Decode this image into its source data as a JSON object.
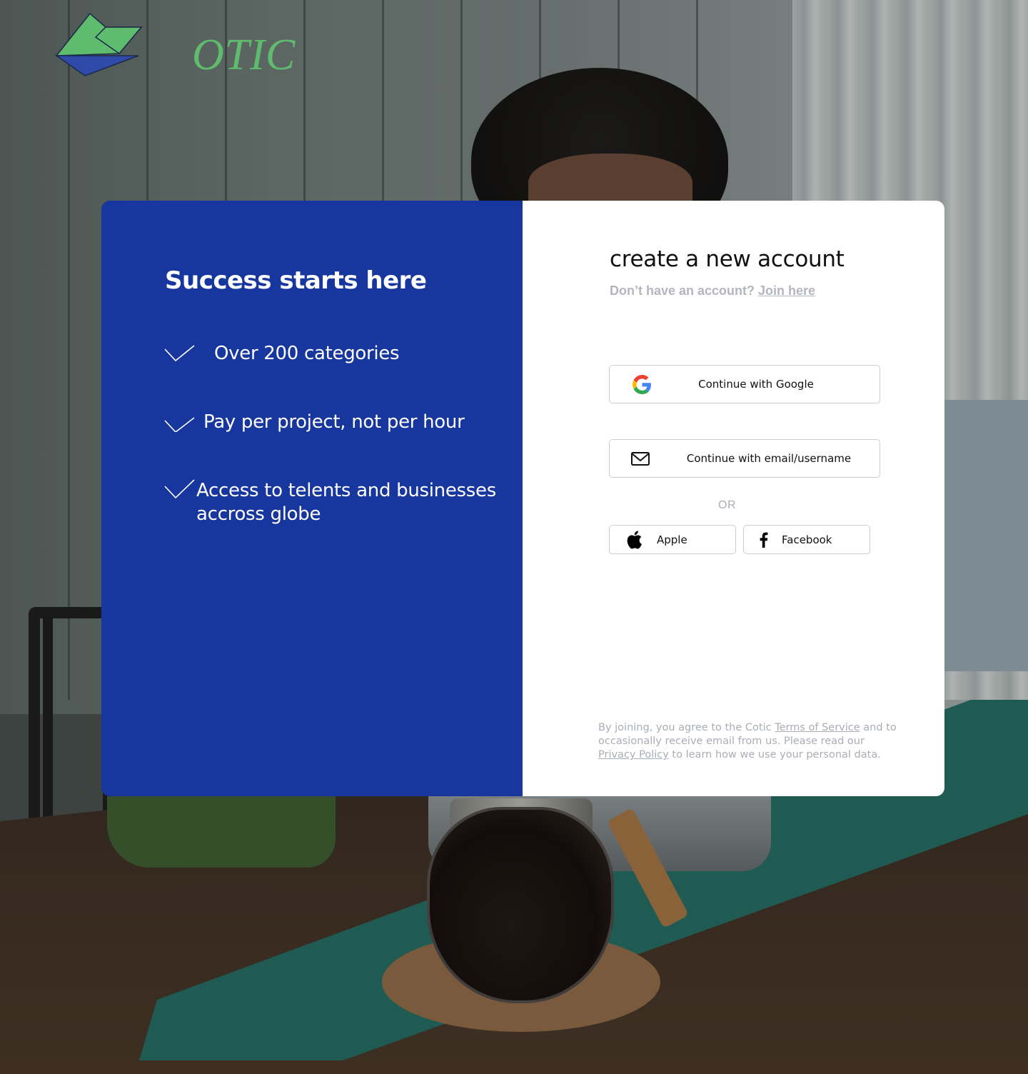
{
  "brand": {
    "logo_text": "OTIC",
    "colors": {
      "green": "#5fbb6e",
      "blue": "#2f4aa8",
      "panel_blue": "#17369e"
    }
  },
  "left": {
    "title": "Success starts here",
    "features": [
      {
        "text": "Over 200 categories",
        "icon": "check-icon"
      },
      {
        "text": "Pay per project, not per hour",
        "icon": "check-icon"
      },
      {
        "text": "Access to telents and businesses accross globe",
        "icon": "check-icon"
      }
    ]
  },
  "right": {
    "title": "create a new account",
    "prompt": "Don’t have an account?",
    "join_link": "Join here",
    "google_label": "Continue with Google",
    "email_label": "Continue with email/username",
    "or_label": "OR",
    "apple_label": "Apple",
    "facebook_label": "Facebook",
    "terms": {
      "part1": "By joining, you agree to the Cotic ",
      "tos_link": "Terms of Service",
      "part2": " and to occasionally receive email from us. Please read our ",
      "privacy_link": "Privacy Policy",
      "part3": " to learn how we use your personal data."
    }
  },
  "icons": {
    "google": "google-icon",
    "email": "mail-icon",
    "apple": "apple-icon",
    "facebook": "facebook-icon"
  }
}
